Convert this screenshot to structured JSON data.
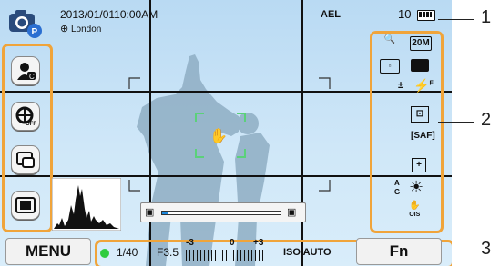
{
  "info": {
    "datetime": "2013/01/01",
    "time": "10:00AM",
    "location": "London",
    "ael": "AEL",
    "shots_remaining": "10"
  },
  "left_menu": {
    "items": [
      {
        "icon": "face-recognition-icon"
      },
      {
        "icon": "shutter-off-icon"
      },
      {
        "icon": "display-icon"
      },
      {
        "icon": "frame-icon"
      }
    ]
  },
  "right_menu": {
    "resolution": "20M",
    "flash_label": "F",
    "focus_mode": "SAF",
    "ois_label": "OIS",
    "wb_a": "A",
    "wb_g": "G"
  },
  "bottom": {
    "menu_label": "MENU",
    "fn_label": "Fn",
    "shutter_speed": "1/40",
    "aperture": "F3.5",
    "ev_min": "-3",
    "ev_mid": "0",
    "ev_max": "+3",
    "iso": "ISO AUTO",
    "exposure_level": 0.5
  },
  "zoom_bar": {
    "level": 0.05
  },
  "callouts": [
    "1",
    "2",
    "3"
  ],
  "colors": {
    "accent": "#f0a43a",
    "sky": "#c4e1f6",
    "focus": "#5bd17a",
    "status_dot": "#2ecc40"
  }
}
